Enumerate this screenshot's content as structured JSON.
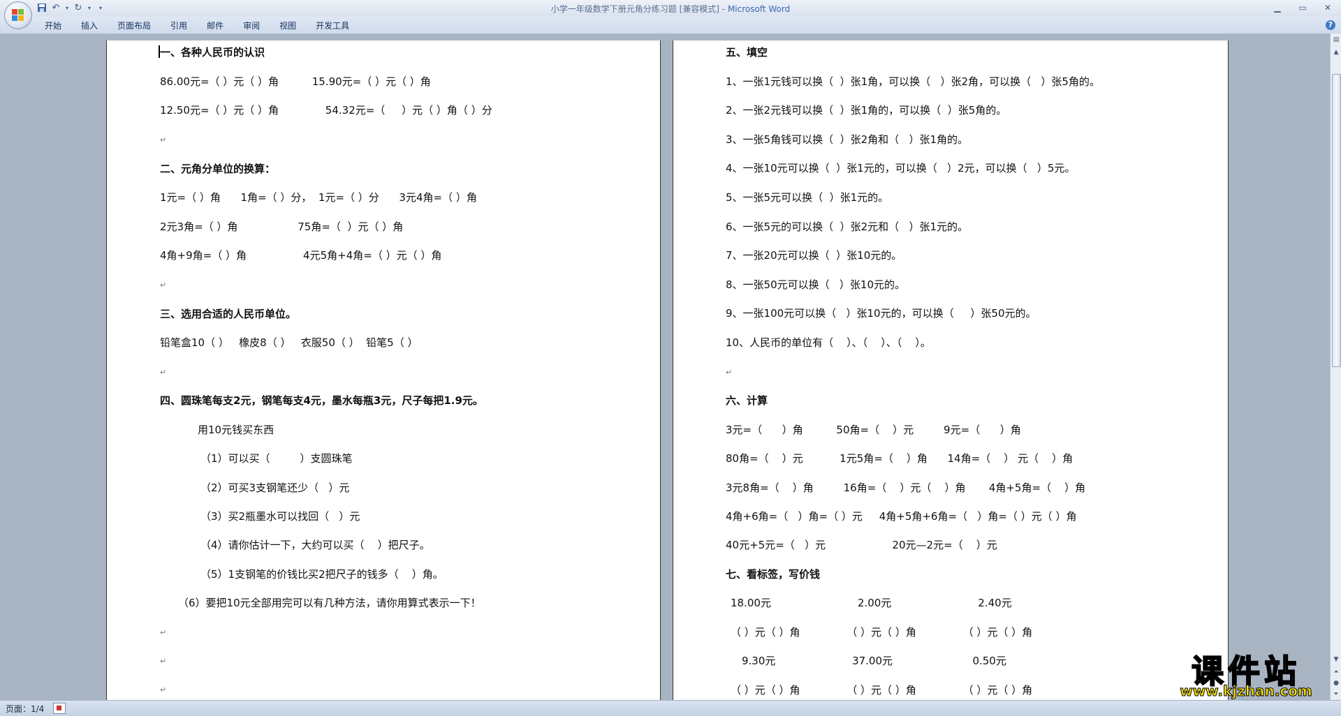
{
  "titlebar": {
    "document_title": "小学一年级数学下册元角分练习题 [兼容模式]",
    "separator": " - ",
    "app_name": "Microsoft Word",
    "qat_icons": [
      "save-icon",
      "undo-icon",
      "redo-icon",
      "customize-icon"
    ]
  },
  "ribbon": {
    "tabs": [
      "开始",
      "插入",
      "页面布局",
      "引用",
      "邮件",
      "审阅",
      "视图",
      "开发工具"
    ],
    "help": "?"
  },
  "left_page": {
    "lines": [
      "一、各种人民币的认识",
      "86.00元=（ ）元（ ）角          15.90元=（ ）元（ ）角",
      "12.50元=（ ）元（ ）角              54.32元=（     ）元（ ）角（ ）分",
      "",
      "二、元角分单位的换算：",
      "1元=（ ）角      1角=（ ）分，  1元=（ ）分      3元4角=（ ）角",
      "2元3角=（ ）角                  75角=（  ）元（ ）角",
      "4角+9角=（ ）角                 4元5角+4角=（ ）元（ ）角",
      "",
      "三、选用合适的人民币单位。",
      "铅笔盒10（ ）   橡皮8（ ）   衣服50（ ）  铅笔5（ ）",
      "",
      "四、圆珠笔每支2元，钢笔每支4元，墨水每瓶3元，尺子每把1.9元。",
      "用10元钱买东西",
      "（1）可以买（         ）支圆珠笔",
      "（2）可买3支钢笔还少（   ）元",
      "（3）买2瓶墨水可以找回（   ）元",
      "（4）请你估计一下，大约可以买（    ）把尺子。",
      "（5）1支钢笔的价钱比买2把尺子的钱多（    ）角。",
      "（6）要把10元全部用完可以有几种方法，请你用算式表示一下！",
      "",
      "",
      ""
    ]
  },
  "right_page": {
    "lines": [
      "五、填空",
      "1、一张1元钱可以换（  ）张1角，可以换（   ）张2角，可以换（   ）张5角的。",
      "2、一张2元钱可以换（  ）张1角的，可以换（  ）张5角的。",
      "3、一张5角钱可以换（  ）张2角和（   ）张1角的。",
      "4、一张10元可以换（  ）张1元的，可以换（   ）2元，可以换（   ）5元。",
      "5、一张5元可以换（  ）张1元的。",
      "6、一张5元的可以换（  ）张2元和（   ）张1元的。",
      "7、一张20元可以换（  ）张10元的。",
      "8、一张50元可以换（   ）张10元的。",
      "9、一张100元可以换（   ）张10元的，可以换（     ）张50元的。",
      "10、人民币的单位有（    ）、（    ）、（    ）。",
      "",
      "六、计算",
      "3元=（      ）角          50角=（    ）元         9元=（      ）角",
      "80角=（    ）元           1元5角=（    ）角      14角=（    ） 元（    ）角",
      "3元8角=（    ）角         16角=（    ）元（    ）角       4角+5角=（    ）角",
      "4角+6角=（   ）角=（ ）元     4角+5角+6角=（   ）角=（ ）元（ ）角",
      "40元+5元=（   ）元                    20元—2元=（    ）元",
      "七、看标签，写价钱",
      "18.00元                          2.00元                          2.40元",
      "（ ）元（ ）角              （ ）元（ ）角              （ ）元（ ）角",
      "9.30元                       37.00元                        0.50元",
      "（ ）元（ ）角              （ ）元（ ）角              （ ）元（ ）角"
    ]
  },
  "statusbar": {
    "page_indicator": "页面：1/4"
  },
  "watermark": {
    "text": "课件站",
    "url": "www.kjzhan.com",
    "color": "#f5e10a"
  },
  "colors": {
    "title_app": "#3a67b0",
    "workspace_bg": "#a9b4c3"
  }
}
